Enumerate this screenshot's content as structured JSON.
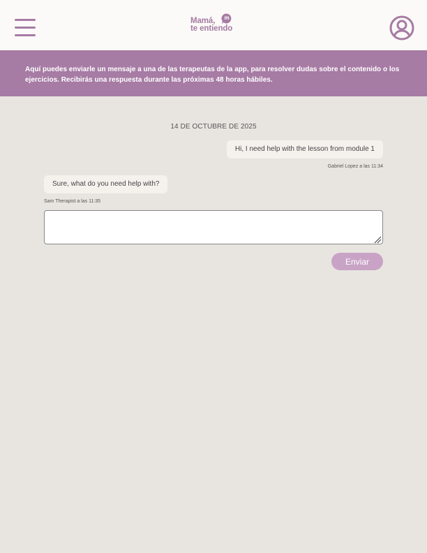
{
  "header": {
    "menu_icon": "hamburger-menu-icon",
    "logo": {
      "line1": "Mamá,",
      "line2": "te entiendo",
      "bubble": "m"
    },
    "profile_icon": "user-profile-icon",
    "accent_color": "#a67ba4"
  },
  "banner": {
    "text": "Aquí puedes enviarle un mensaje a una de las terapeutas de la app, para resolver dudas sobre el contenido o los ejercicios. Recibirás una respuesta durante las próximas 48 horas hábiles."
  },
  "chat": {
    "date": "14 DE OCTUBRE DE 2025",
    "messages": [
      {
        "direction": "outgoing",
        "text": "Hi, I need help with the lesson from module 1",
        "meta": "Gabriel Lopez a las 11:34"
      },
      {
        "direction": "incoming",
        "text": "Sure, what do you need help with?",
        "meta": "Sam Therapist a las 11:35"
      }
    ]
  },
  "composer": {
    "value": "",
    "send_label": "Enviar"
  },
  "colors": {
    "background": "#e8e5e0",
    "header": "#fcfaf8",
    "banner": "#a67ba4",
    "bubble": "#f5f2ee",
    "send_button": "#c8a3c6"
  }
}
